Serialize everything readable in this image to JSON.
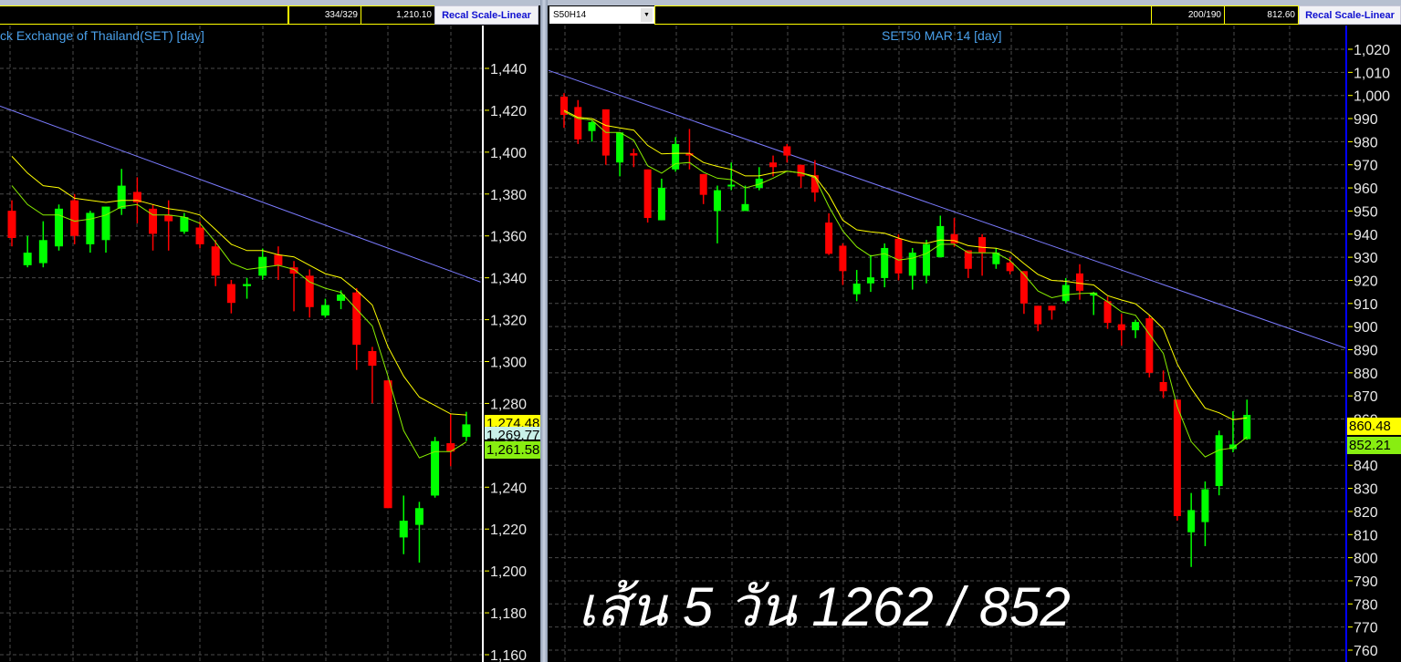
{
  "left_panel": {
    "title": "ck Exchange of Thailand(SET) [day]",
    "count": "334/329",
    "value": "1,210.10",
    "recal_button": "Recal Scale-Linear",
    "price_labels": [
      {
        "text": "1,274.48",
        "color": "#ffff00"
      },
      {
        "text": "1,269.77",
        "color": "#c8f0e8"
      },
      {
        "text": "1,261.58",
        "color": "#88ee11"
      }
    ]
  },
  "right_panel": {
    "symbol_select": "S50H14",
    "title": "SET50 MAR 14   [day]",
    "count": "200/190",
    "value": "812.60",
    "recal_button": "Recal Scale-Linear",
    "price_labels": [
      {
        "text": "860.48",
        "color": "#ffff00"
      },
      {
        "text": "852.21",
        "color": "#88ee11"
      }
    ]
  },
  "overlay_text": "เส้น 5 วัน 1262 / 852",
  "colors": {
    "up": "#00ff00",
    "down": "#ff0000",
    "ma_long": "#ffff00",
    "ma_short": "#88ee00",
    "trendline": "#7b7bff",
    "grid": "#4a4a4a"
  },
  "chart_data": [
    {
      "type": "candlestick",
      "title": "ck Exchange of Thailand(SET) [day]",
      "ylim": [
        1160,
        1440
      ],
      "yticks": [
        "1,160",
        "1,180",
        "1,200",
        "1,220",
        "1,240",
        "1,260",
        "1,280",
        "1,300",
        "1,320",
        "1,340",
        "1,360",
        "1,380",
        "1,400",
        "1,420",
        "1,440"
      ],
      "ytick_values": [
        1160,
        1180,
        1200,
        1220,
        1240,
        1260,
        1280,
        1300,
        1320,
        1340,
        1360,
        1380,
        1400,
        1420,
        1440
      ],
      "grid": true,
      "ohlc": [
        [
          1372,
          1377,
          1355,
          1359
        ],
        [
          1346,
          1360,
          1345,
          1352
        ],
        [
          1347,
          1367,
          1345,
          1358
        ],
        [
          1355,
          1375,
          1353,
          1373
        ],
        [
          1377,
          1380,
          1356,
          1360
        ],
        [
          1356,
          1372,
          1352,
          1371
        ],
        [
          1358,
          1374,
          1352,
          1374
        ],
        [
          1373,
          1392,
          1370,
          1384
        ],
        [
          1381,
          1388,
          1366,
          1376
        ],
        [
          1373,
          1375,
          1353,
          1361
        ],
        [
          1370,
          1377,
          1353,
          1367
        ],
        [
          1362,
          1371,
          1361,
          1369
        ],
        [
          1364,
          1367,
          1354,
          1356
        ],
        [
          1355,
          1358,
          1336,
          1341
        ],
        [
          1337,
          1339,
          1323,
          1328
        ],
        [
          1336,
          1340,
          1330,
          1337
        ],
        [
          1341,
          1354,
          1339,
          1350
        ],
        [
          1351,
          1355,
          1339,
          1346
        ],
        [
          1345,
          1348,
          1324,
          1342
        ],
        [
          1341,
          1344,
          1321,
          1326
        ],
        [
          1322,
          1330,
          1321,
          1327
        ],
        [
          1329,
          1334,
          1325,
          1332
        ],
        [
          1333,
          1335,
          1296,
          1308
        ],
        [
          1305,
          1307,
          1280,
          1298
        ],
        [
          1291,
          1291,
          1230,
          1230
        ],
        [
          1216,
          1236,
          1208,
          1224
        ],
        [
          1222,
          1233,
          1204,
          1230
        ],
        [
          1236,
          1264,
          1235,
          1262
        ],
        [
          1261,
          1275,
          1250,
          1257
        ],
        [
          1264,
          1276,
          1262,
          1270
        ]
      ],
      "series": [
        {
          "color": "#ffff00",
          "values": [
            1398,
            1390,
            1384,
            1383,
            1378,
            1377,
            1376,
            1377,
            1377,
            1375,
            1373,
            1372,
            1370,
            1363,
            1356,
            1353,
            1353,
            1351,
            1350,
            1346,
            1342,
            1340,
            1334,
            1327,
            1307,
            1293,
            1283,
            1279,
            1275,
            1274.48
          ]
        },
        {
          "color": "#88ee00",
          "values": [
            1384,
            1375,
            1370,
            1370,
            1367,
            1368,
            1370,
            1374,
            1375,
            1370,
            1370,
            1369,
            1366,
            1357,
            1347,
            1344,
            1345,
            1346,
            1344,
            1338,
            1335,
            1333,
            1325,
            1317,
            1293,
            1267,
            1254,
            1257,
            1257,
            1261.58
          ]
        }
      ],
      "trendline": {
        "x": [
          -0.76,
          29.9
        ],
        "y": [
          1422,
          1338
        ]
      }
    },
    {
      "type": "candlestick",
      "title": "SET50 MAR 14   [day]",
      "ylim": [
        760,
        1020
      ],
      "yticks": [
        "760",
        "770",
        "780",
        "790",
        "800",
        "810",
        "820",
        "830",
        "840",
        "850",
        "860",
        "870",
        "880",
        "890",
        "900",
        "910",
        "920",
        "930",
        "940",
        "950",
        "960",
        "970",
        "980",
        "990",
        "1,000",
        "1,010",
        "1,020"
      ],
      "ytick_values": [
        760,
        770,
        780,
        790,
        800,
        810,
        820,
        830,
        840,
        850,
        860,
        870,
        880,
        890,
        900,
        910,
        920,
        930,
        940,
        950,
        960,
        970,
        980,
        990,
        1000,
        1010,
        1020
      ],
      "grid": true,
      "ohlc": [
        [
          999.5,
          1001,
          986,
          991.6
        ],
        [
          995,
          998,
          979,
          981
        ],
        [
          984.6,
          989,
          980,
          988.5
        ],
        [
          994,
          994,
          970,
          974
        ],
        [
          971,
          984,
          965,
          984
        ],
        [
          975,
          977,
          969,
          974
        ],
        [
          968,
          968,
          945,
          947
        ],
        [
          946,
          964,
          946,
          960
        ],
        [
          968,
          982,
          967,
          979
        ],
        [
          975,
          985.5,
          968,
          974
        ],
        [
          966,
          966,
          953,
          957
        ],
        [
          950,
          961,
          936,
          959
        ],
        [
          960.6,
          971,
          959,
          961.4
        ],
        [
          950,
          961,
          950,
          953
        ],
        [
          960,
          969,
          959,
          964
        ],
        [
          971,
          974,
          965,
          969
        ],
        [
          978,
          979,
          971,
          974
        ],
        [
          970,
          970,
          960,
          965
        ],
        [
          965.5,
          972,
          954,
          958
        ],
        [
          945,
          949,
          931,
          931.5
        ],
        [
          935,
          936,
          918,
          924
        ],
        [
          914,
          924.5,
          911,
          918.6
        ],
        [
          918.7,
          931,
          915,
          921.3
        ],
        [
          921,
          936,
          917,
          934
        ],
        [
          938,
          940,
          920,
          923
        ],
        [
          922,
          934,
          916,
          932
        ],
        [
          922,
          937.5,
          918.7,
          935.7
        ],
        [
          930,
          948,
          930,
          943.5
        ],
        [
          940,
          947,
          934.5,
          936
        ],
        [
          933,
          933,
          921,
          925
        ],
        [
          938.7,
          940,
          922,
          932
        ],
        [
          927,
          934,
          925,
          932
        ],
        [
          927.7,
          930,
          922.6,
          924
        ],
        [
          924,
          924,
          905.5,
          910
        ],
        [
          909,
          909,
          898,
          901
        ],
        [
          909,
          909,
          903,
          907
        ],
        [
          911,
          921,
          910,
          918
        ],
        [
          923,
          927,
          911.6,
          915.5
        ],
        [
          913.4,
          915,
          905,
          914.7
        ],
        [
          911,
          913,
          899,
          901.6
        ],
        [
          901,
          905.5,
          891.7,
          898.4
        ],
        [
          898.4,
          903,
          895,
          902
        ],
        [
          903.6,
          905,
          878,
          880
        ],
        [
          876,
          881,
          869,
          872
        ],
        [
          868.4,
          868.4,
          816,
          818
        ],
        [
          811,
          828,
          796,
          820.6
        ],
        [
          815.4,
          833,
          805,
          829.6
        ],
        [
          831,
          855,
          827,
          853
        ],
        [
          847,
          863.4,
          845.6,
          849
        ],
        [
          851.3,
          868.4,
          851,
          861.8
        ]
      ],
      "series": [
        {
          "color": "#ffff00",
          "values": [
            993.6,
            990.5,
            990,
            987,
            986,
            985,
            978.4,
            974.7,
            975,
            975,
            971,
            969.3,
            968,
            965.2,
            965.2,
            966.5,
            967.2,
            966.5,
            965,
            957,
            946,
            941.9,
            941,
            940.4,
            938.3,
            936.5,
            936,
            937.5,
            937.2,
            935,
            934.3,
            933.9,
            932.3,
            927.3,
            922.6,
            920,
            919.6,
            918.7,
            918,
            913.4,
            911.5,
            909.9,
            905,
            899,
            883.8,
            873.2,
            864.7,
            862.7,
            859.7,
            860.48
          ]
        },
        {
          "color": "#88ee00",
          "values": [
            993,
            990,
            989.4,
            984,
            984,
            980.6,
            969.6,
            966.4,
            970.5,
            971,
            966.8,
            964.2,
            963.6,
            960,
            961.6,
            964.2,
            967.2,
            966.5,
            964.4,
            952,
            941.4,
            934.5,
            930.5,
            931.6,
            928.8,
            929.6,
            931.6,
            935.6,
            935.6,
            932,
            931.9,
            931.9,
            928.6,
            922.6,
            915.4,
            912.5,
            913.8,
            914.3,
            914.5,
            910.8,
            906.4,
            904.9,
            896.7,
            888.4,
            865.3,
            850.2,
            843.6,
            846.6,
            847.5,
            852.21
          ]
        }
      ],
      "trendline": {
        "x": [
          -1.2,
          56.4
        ],
        "y": [
          1011,
          890
        ]
      }
    }
  ]
}
